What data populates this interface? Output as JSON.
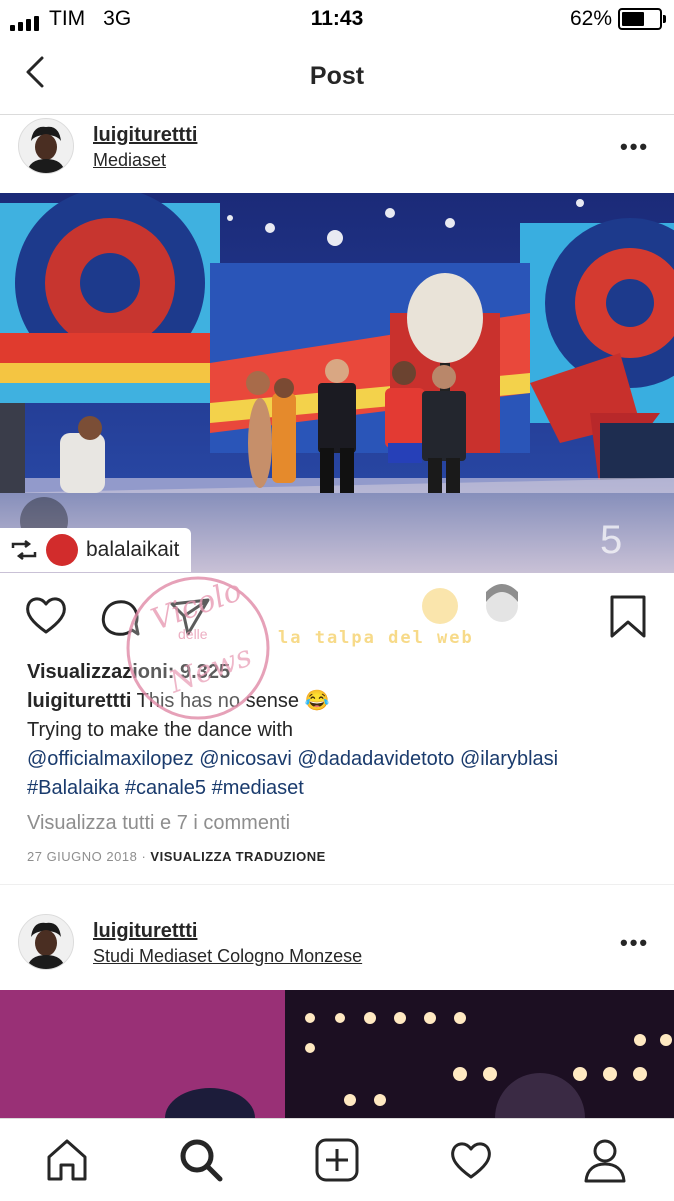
{
  "status_bar": {
    "carrier": "TIM",
    "network": "3G",
    "time": "11:43",
    "battery_percent": "62%",
    "battery_level": 0.62
  },
  "nav": {
    "title": "Post",
    "back_icon": "chevron-left-icon"
  },
  "post": {
    "username": "luigiturettti",
    "location": "Mediaset",
    "more_label": "•••",
    "repost_username": "balalaikait",
    "caption_username": "luigiturettti",
    "views_label": "Visualizzazioni:",
    "views_count": "9.325",
    "caption_text": "This has no sense 😂",
    "caption_line2": "Trying to make the dance with",
    "mentions": "@officialmaxilopez @nicosavi @dadadavidetoto @ilaryblasi",
    "hashtags": "#Balalaika #canale5 #mediaset",
    "view_comments": "Visualizza tutti e 7 i commenti",
    "date": "27 GIUGNO 2018",
    "separator": "·",
    "translate": "VISUALIZZA TRADUZIONE"
  },
  "next_post": {
    "username": "luigiturettti",
    "location": "Studi Mediaset Cologno Monzese",
    "more_label": "•••"
  },
  "watermark": {
    "line1": "Vicolo",
    "line2": "delle",
    "line3": "News",
    "tagline": "la talpa del web"
  },
  "tab_bar": [
    "home-icon",
    "search-icon",
    "add-icon",
    "heart-icon",
    "profile-icon"
  ]
}
